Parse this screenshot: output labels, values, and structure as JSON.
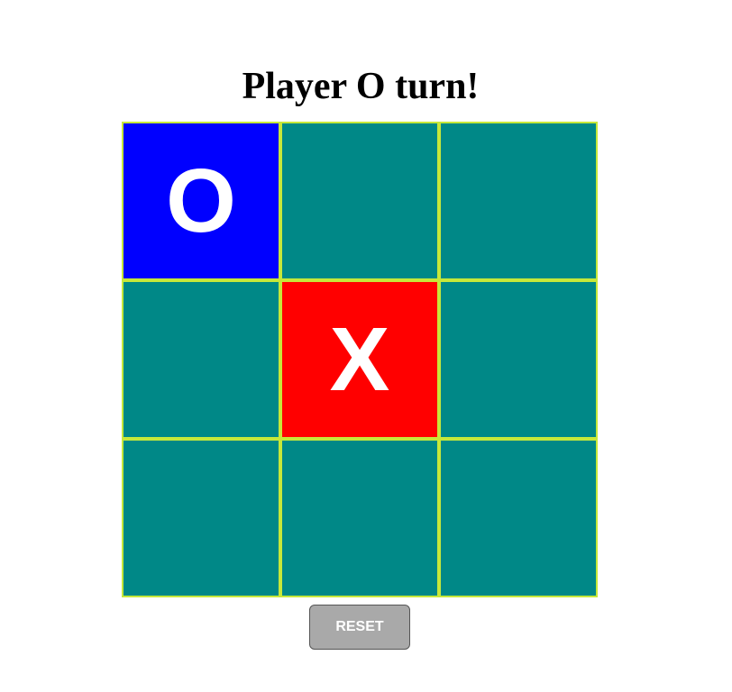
{
  "status": {
    "text": "Player O turn!"
  },
  "board": {
    "cells": [
      "O",
      "",
      "",
      "",
      "X",
      "",
      "",
      "",
      ""
    ]
  },
  "colors": {
    "empty": "#008887",
    "O": "#0000ff",
    "X": "#ff0000",
    "grid_line": "#c6e83a",
    "mark_text": "#ffffff",
    "reset_button": "#a9a9a9"
  },
  "controls": {
    "reset_label": "RESET"
  }
}
